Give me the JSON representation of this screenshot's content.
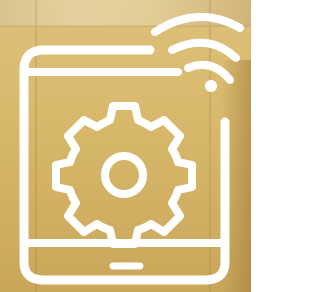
{
  "icon": {
    "name": "tablet-settings-wifi-icon",
    "parts": [
      "tablet-icon",
      "gear-icon",
      "wifi-signal-icon",
      "home-bar"
    ]
  },
  "colors": {
    "background": "#d8b96c",
    "stroke": "#ffffff"
  }
}
